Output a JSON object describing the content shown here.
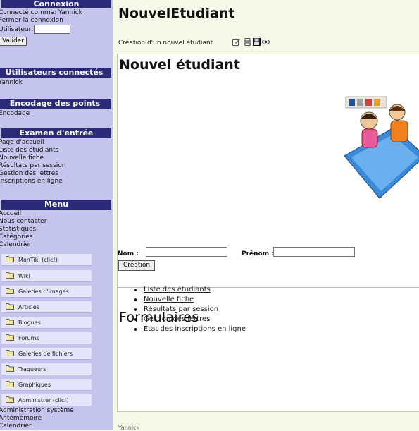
{
  "sidebar": {
    "connexion": {
      "title": "Connexion",
      "connected_as": "Connecté comme: Yannick",
      "close_link": "Fermer la connexion",
      "user_label": "Utilisateur:",
      "user_value": "",
      "submit": "Valider"
    },
    "users": {
      "title": "Utilisateurs connectés",
      "items": [
        "Yannick"
      ]
    },
    "encodage": {
      "title": "Encodage des points",
      "items": [
        "Encodage"
      ]
    },
    "examen": {
      "title": "Examen d'entrée",
      "items": [
        "Page d'accueil",
        "Liste des étudiants",
        "Nouvelle fiche",
        "Résultats par session",
        "Gestion des lettres",
        "Inscriptions en ligne"
      ]
    },
    "menu": {
      "title": "Menu",
      "items": [
        "Accueil",
        "Nous contacter",
        "Statistiques",
        "Catégories",
        "Calendrier"
      ],
      "folders": [
        "MonTiki (clic!)",
        "Wiki",
        "Galeries d'images",
        "Articles",
        "Blogues",
        "Forums",
        "Galeries de fichiers",
        "Traqueurs",
        "Graphiques",
        "Administrer (clic!)"
      ],
      "bottom": [
        "Administration système",
        "Antémémoire",
        "Calendrier"
      ]
    }
  },
  "main": {
    "page_title": "NouvelEtudiant",
    "subtitle": "Création d'un nouvel étudiant",
    "box_title": "Nouvel étudiant",
    "form": {
      "nom_label": "Nom :",
      "nom_value": "",
      "prenom_label": "Prénom :",
      "prenom_value": "",
      "button": "Création"
    },
    "formulaires_title": "Formulaires",
    "links": [
      "Liste des étudiants",
      "Nouvelle fiche",
      "Résultats par session",
      "Gestion des lettres",
      "État des inscriptions en ligne"
    ],
    "footer": "Yannick"
  },
  "colors": {
    "sidebar_bg": "#c4c4ec",
    "sidebar_header": "#2a2a78",
    "page_bg": "#f6f8e8",
    "menu_item_bg": "#e4e4fa"
  }
}
